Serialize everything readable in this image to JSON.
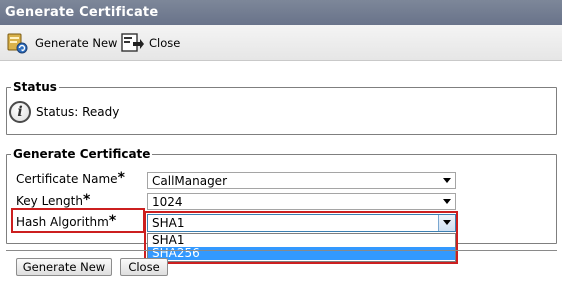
{
  "window": {
    "title": "Generate Certificate"
  },
  "toolbar": {
    "generate_new_label": "Generate New",
    "generate_new_icon": "certificate-generate-icon",
    "close_label": "Close",
    "close_icon": "close-document-icon"
  },
  "status": {
    "legend": "Status",
    "icon": "info-icon",
    "text": "Status: Ready"
  },
  "form": {
    "legend": "Generate Certificate",
    "certificate_name": {
      "label": "Certificate Name",
      "required_mark": "*",
      "value": "CallManager"
    },
    "key_length": {
      "label": "Key Length",
      "required_mark": "*",
      "value": "1024"
    },
    "hash_algorithm": {
      "label": "Hash Algorithm",
      "required_mark": "*",
      "value": "SHA1",
      "options": [
        "SHA1",
        "SHA256"
      ],
      "highlighted_option": "SHA256"
    }
  },
  "buttons": {
    "generate_new": "Generate New",
    "close": "Close"
  },
  "colors": {
    "highlight_border": "#cc1f1f",
    "selected_option": "#3399ff",
    "title_bar": "#737d92"
  }
}
